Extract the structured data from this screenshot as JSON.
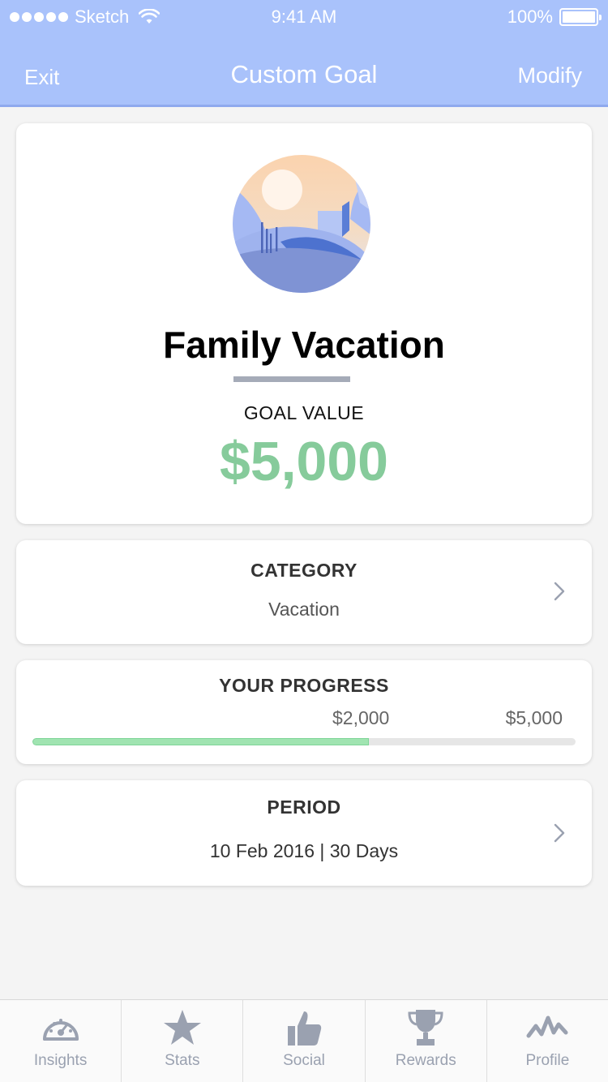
{
  "status_bar": {
    "carrier": "Sketch",
    "time": "9:41 AM",
    "battery": "100%"
  },
  "nav": {
    "left_label": "Exit",
    "title": "Custom Goal",
    "right_label": "Modify"
  },
  "goal": {
    "illustration": "vacation-landscape",
    "name": "Family Vacation",
    "value_label": "GOAL VALUE",
    "value": "$5,000",
    "value_color": "#86cb9b"
  },
  "category": {
    "heading": "CATEGORY",
    "value": "Vacation"
  },
  "progress": {
    "heading": "YOUR PROGRESS",
    "current": "$2,000",
    "target": "$5,000",
    "fill_fraction": 0.62
  },
  "period": {
    "heading": "PERIOD",
    "value": "10 Feb 2016 | 30 Days"
  },
  "tabs": [
    {
      "label": "Insights",
      "icon": "gauge-icon"
    },
    {
      "label": "Stats",
      "icon": "star-icon"
    },
    {
      "label": "Social",
      "icon": "thumbs-up-icon"
    },
    {
      "label": "Rewards",
      "icon": "trophy-icon"
    },
    {
      "label": "Profile",
      "icon": "activity-icon"
    }
  ],
  "colors": {
    "header": "#a9c2fb",
    "accent_green": "#86cb9b",
    "tab_icon": "#9aa1b0"
  }
}
